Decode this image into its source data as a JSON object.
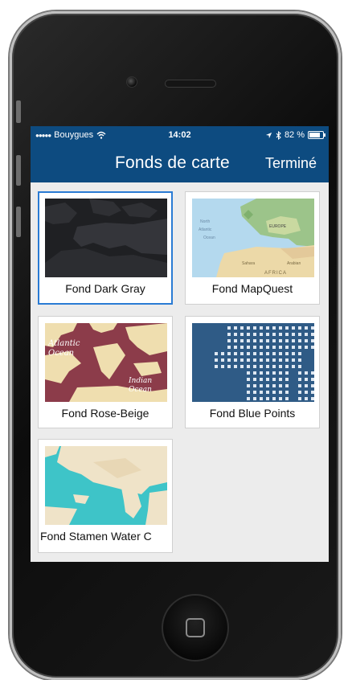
{
  "status_bar": {
    "signal": "●●●●●",
    "carrier": "Bouygues",
    "wifi_icon": "wifi-icon",
    "time": "14:02",
    "location_icon": "location-arrow-icon",
    "bluetooth_icon": "bluetooth-icon",
    "battery": "82 %"
  },
  "nav": {
    "title": "Fonds de carte",
    "done_label": "Terminé"
  },
  "basemaps": [
    {
      "label": "Fond Dark Gray",
      "selected": true
    },
    {
      "label": "Fond MapQuest",
      "selected": false
    },
    {
      "label": "Fond Rose-Beige",
      "selected": false
    },
    {
      "label": "Fond Blue Points",
      "selected": false
    },
    {
      "label": "Fond Stamen Water C",
      "selected": false
    }
  ],
  "thumbnails": {
    "mapquest": [
      "North",
      "Atlantic",
      "Ocean",
      "EUROPE",
      "Sahara",
      "Arabian",
      "AFRICA"
    ],
    "rose_beige": [
      "Atlantic",
      "Ocean",
      "Indian",
      "Ocean"
    ]
  },
  "colors": {
    "nav_bg": "#0d4b80",
    "selected_border": "#2a7bd4",
    "screen_bg": "#ececec"
  }
}
